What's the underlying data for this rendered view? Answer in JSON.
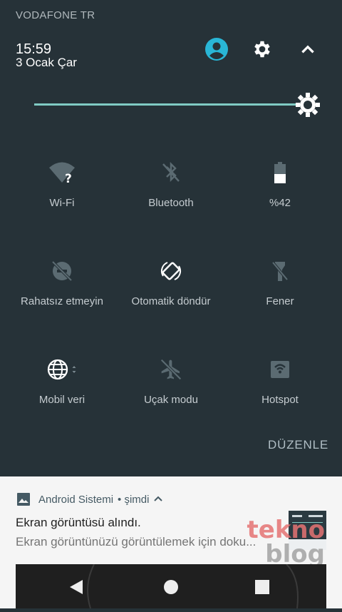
{
  "status": {
    "carrier": "VODAFONE TR"
  },
  "header": {
    "time": "15:59",
    "date": "3 Ocak Çar"
  },
  "brightness": {
    "level": 0.95
  },
  "tiles": [
    {
      "label": "Wi-Fi",
      "icon": "wifi-unknown-icon"
    },
    {
      "label": "Bluetooth",
      "icon": "bluetooth-off-icon"
    },
    {
      "label": "%42",
      "icon": "battery-icon"
    },
    {
      "label": "Rahatsız etmeyin",
      "icon": "do-not-disturb-off-icon"
    },
    {
      "label": "Otomatik döndür",
      "icon": "auto-rotate-icon"
    },
    {
      "label": "Fener",
      "icon": "flashlight-off-icon"
    },
    {
      "label": "Mobil veri",
      "icon": "globe-icon"
    },
    {
      "label": "Uçak modu",
      "icon": "airplane-icon"
    },
    {
      "label": "Hotspot",
      "icon": "hotspot-icon"
    }
  ],
  "edit_label": "DÜZENLE",
  "notification": {
    "app": "Android Sistemi",
    "time": "• şimdi",
    "title": "Ekran görüntüsü alındı.",
    "text": "Ekran görüntünüzü görüntülemek için doku..."
  },
  "watermark": {
    "line1": "tekno",
    "line2": "blog"
  }
}
